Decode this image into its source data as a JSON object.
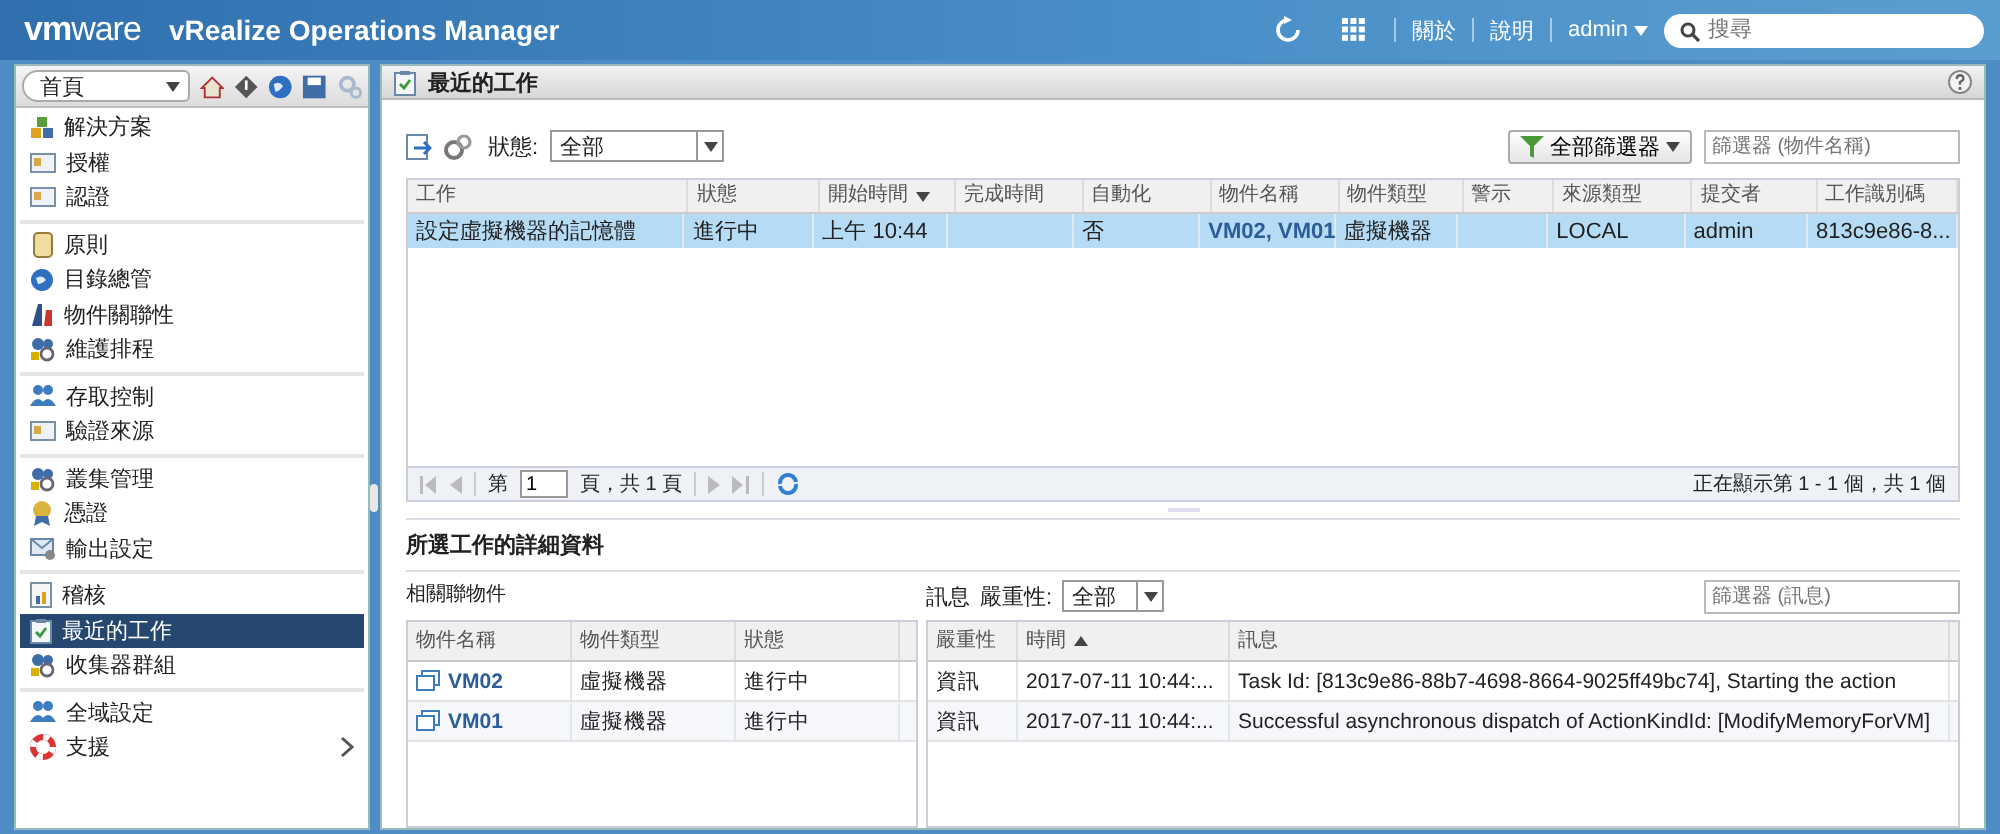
{
  "header": {
    "logo": "**vm**ware",
    "app_title": "vRealize Operations Manager",
    "links": [
      "關於",
      "說明"
    ],
    "user": "admin",
    "search": {
      "placeholder": "搜尋"
    }
  },
  "sidebar": {
    "dropdown": "首頁",
    "groups": [
      [
        {
          "label": "解決方案",
          "selected": false,
          "expandable": false
        },
        {
          "label": "授權",
          "selected": false,
          "expandable": false
        },
        {
          "label": "認證",
          "selected": false,
          "expandable": false
        }
      ],
      [
        {
          "label": "原則",
          "selected": false,
          "expandable": false
        },
        {
          "label": "目錄總管",
          "selected": false,
          "expandable": false
        },
        {
          "label": "物件關聯性",
          "selected": false,
          "expandable": false
        },
        {
          "label": "維護排程",
          "selected": false,
          "expandable": false
        }
      ],
      [
        {
          "label": "存取控制",
          "selected": false,
          "expandable": false
        },
        {
          "label": "驗證來源",
          "selected": false,
          "expandable": false
        }
      ],
      [
        {
          "label": "叢集管理",
          "selected": false,
          "expandable": false
        },
        {
          "label": "憑證",
          "selected": false,
          "expandable": false
        },
        {
          "label": "輸出設定",
          "selected": false,
          "expandable": false
        }
      ],
      [
        {
          "label": "稽核",
          "selected": false,
          "expandable": false
        },
        {
          "label": "最近的工作",
          "selected": true,
          "expandable": false
        },
        {
          "label": "收集器群組",
          "selected": false,
          "expandable": false
        }
      ],
      [
        {
          "label": "全域設定",
          "selected": false,
          "expandable": false
        },
        {
          "label": "支援",
          "selected": false,
          "expandable": true
        }
      ]
    ]
  },
  "main": {
    "title": "最近的工作",
    "toolbar": {
      "status_label": "狀態:",
      "status_value": "全部",
      "filter_button": "全部篩選器",
      "filter_placeholder": "篩選器 (物件名稱)"
    },
    "tasks": {
      "columns": [
        {
          "label": "工作",
          "sorted": false
        },
        {
          "label": "狀態",
          "sorted": false
        },
        {
          "label": "開始時間",
          "sorted": true
        },
        {
          "label": "完成時間",
          "sorted": false
        },
        {
          "label": "自動化",
          "sorted": false
        },
        {
          "label": "物件名稱",
          "sorted": false
        },
        {
          "label": "物件類型",
          "sorted": false
        },
        {
          "label": "警示",
          "sorted": false
        },
        {
          "label": "來源類型",
          "sorted": false
        },
        {
          "label": "提交者",
          "sorted": false
        },
        {
          "label": "工作識別碼",
          "sorted": false
        }
      ],
      "rows": [
        {
          "selected": true,
          "cells": [
            "設定虛擬機器的記憶體",
            "進行中",
            "上午 10:44",
            "",
            "否",
            "VM02, VM01",
            "虛擬機器",
            "",
            "LOCAL",
            "admin",
            "813c9e86-8..."
          ]
        }
      ]
    },
    "pagination": {
      "page_prefix": "第",
      "page": "1",
      "page_suffix": "頁，共 1 頁",
      "showing": "正在顯示第 1 - 1 個，共 1 個"
    },
    "details": {
      "title": "所選工作的詳細資料",
      "related": {
        "label": "相關聯物件",
        "columns": [
          "物件名稱",
          "物件類型",
          "狀態"
        ],
        "rows": [
          {
            "selected": false,
            "cells": [
              "VM02",
              "虛擬機器",
              "進行中"
            ]
          },
          {
            "selected": false,
            "cells": [
              "VM01",
              "虛擬機器",
              "進行中"
            ]
          }
        ]
      },
      "messages": {
        "label": "訊息",
        "severity_label": "嚴重性:",
        "severity_value": "全部",
        "filter_placeholder": "篩選器 (訊息)",
        "columns": [
          {
            "label": "嚴重性",
            "sorted": false
          },
          {
            "label": "時間",
            "sorted": true
          },
          {
            "label": "訊息",
            "sorted": false
          }
        ],
        "rows": [
          {
            "cells": [
              "資訊",
              "2017-07-11 10:44:...",
              "Task Id: [813c9e86-88b7-4698-8664-9025ff49bc74], Starting the action"
            ]
          },
          {
            "cells": [
              "資訊",
              "2017-07-11 10:44:...",
              "Successful asynchronous dispatch of ActionKindId: [ModifyMemoryForVM]"
            ]
          }
        ]
      }
    }
  }
}
